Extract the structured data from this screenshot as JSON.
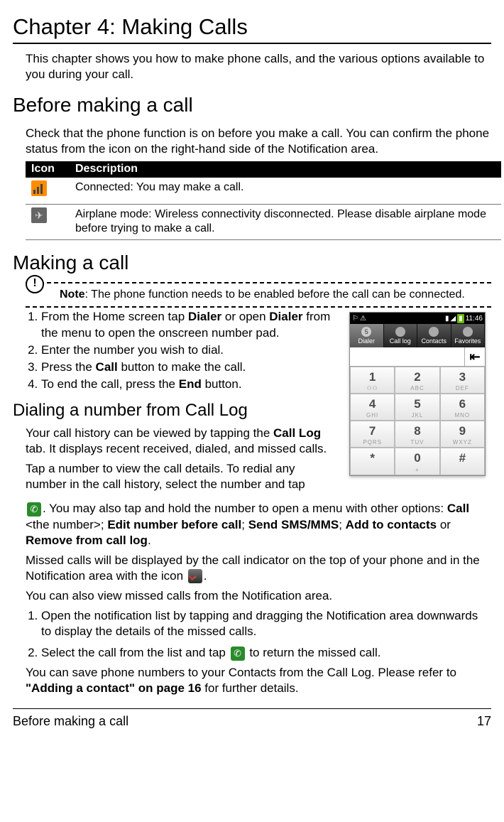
{
  "chapter_title": "Chapter 4: Making Calls",
  "intro": "This chapter shows you how to make phone calls, and the various options available to you during your call.",
  "before": {
    "heading": "Before making a call",
    "body": "Check that the phone function is on before you make a call. You can confirm the phone status from the icon on the right-hand side of the Notification area.",
    "col_icon": "Icon",
    "col_desc": "Description",
    "rows": [
      {
        "desc": "Connected: You may make a call."
      },
      {
        "desc": "Airplane mode: Wireless connectivity disconnected. Please disable airplane mode before trying to make a call."
      }
    ]
  },
  "making": {
    "heading": "Making a call",
    "note_label": "Note",
    "note_body": ": The phone function needs to be enabled before the call can be connected.",
    "step1_a": "From the Home screen tap ",
    "step1_b": "Dialer",
    "step1_c": " or open ",
    "step1_d": "Dialer",
    "step1_e": " from the menu to open the onscreen number pad.",
    "step2": "Enter the number you wish to dial.",
    "step3_a": "Press the ",
    "step3_b": "Call",
    "step3_c": " button to make the call.",
    "step4_a": "To end the call, press the ",
    "step4_b": "End",
    "step4_c": " button."
  },
  "dialer": {
    "clock": "11:46",
    "badge": "5",
    "tabs": [
      "Dialer",
      "Call log",
      "Contacts",
      "Favorites"
    ],
    "del": "⇤",
    "keys": [
      {
        "d": "1",
        "l": "⚇⚇"
      },
      {
        "d": "2",
        "l": "ABC"
      },
      {
        "d": "3",
        "l": "DEF"
      },
      {
        "d": "4",
        "l": "GHI"
      },
      {
        "d": "5",
        "l": "JKL"
      },
      {
        "d": "6",
        "l": "MNO"
      },
      {
        "d": "7",
        "l": "PQRS"
      },
      {
        "d": "8",
        "l": "TUV"
      },
      {
        "d": "9",
        "l": "WXYZ"
      },
      {
        "d": "*",
        "l": ""
      },
      {
        "d": "0",
        "l": "+"
      },
      {
        "d": "#",
        "l": ""
      }
    ]
  },
  "calllog": {
    "heading": "Dialing a number from Call Log",
    "p1_a": "Your call history can be viewed by tapping the ",
    "p1_b": "Call Log",
    "p1_c": " tab. It displays recent received, dialed, and missed calls.",
    "p2": "Tap a number to view the call details. To redial any number in the call history, select the number and tap ",
    "p3_a": ". You may also tap and hold the number to open a menu with other options: ",
    "p3_b": "Call",
    "p3_c": " <the number>; ",
    "p3_d": "Edit number before call",
    "p3_e": "; ",
    "p3_f": "Send SMS/MMS",
    "p3_g": "; ",
    "p3_h": "Add to contacts",
    "p3_i": " or ",
    "p3_j": "Remove from call log",
    "p3_k": ".",
    "p4_a": "Missed calls will be displayed by the call indicator on the top of your phone and in the Notification area with the icon ",
    "p4_b": ".",
    "p5": "You can also view missed calls from the Notification area.",
    "n1": "Open the notification list by tapping and dragging the Notification area downwards to display the details of the missed calls.",
    "n2_a": "Select the call from the list and tap ",
    "n2_b": " to return the missed call.",
    "p6_a": "You can save phone numbers to your Contacts from the Call Log. Please refer to ",
    "p6_b": "\"Adding a contact\" on page 16",
    "p6_c": " for further details."
  },
  "footer": {
    "left": "Before making a call",
    "right": "17"
  }
}
